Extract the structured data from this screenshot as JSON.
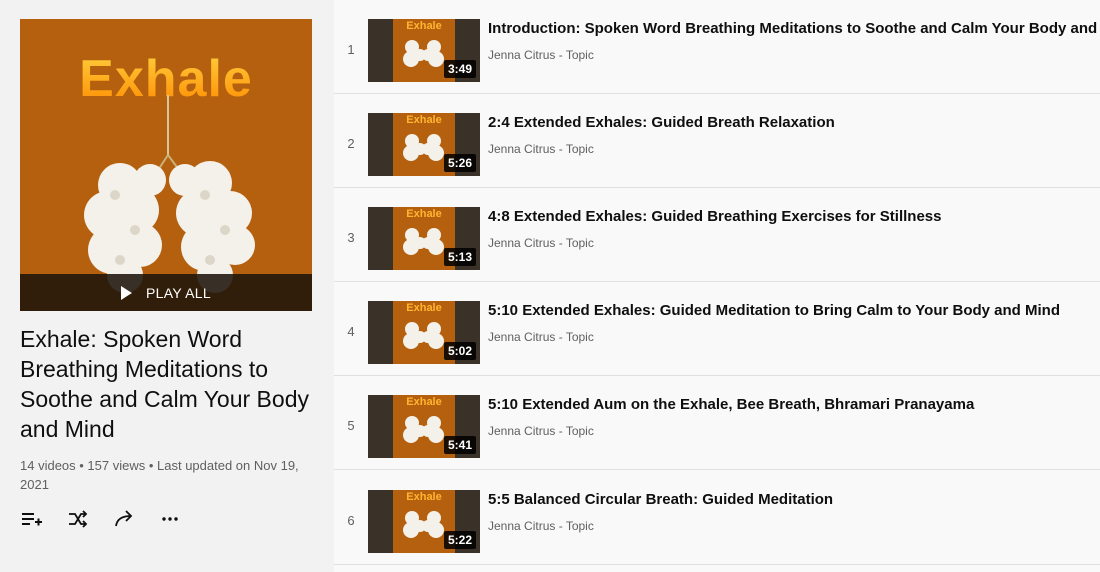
{
  "playlist": {
    "cover_title": "Exhale",
    "play_all_label": "PLAY ALL",
    "title": "Exhale: Spoken Word Breathing Meditations to Soothe and Calm Your Body and Mind",
    "meta": "14 videos • 157 views • Last updated on Nov 19, 2021",
    "colors": {
      "cover_bg": "#b5600f",
      "thumb_frame": "#3a3128"
    },
    "actions": [
      {
        "icon": "add-to-queue-icon"
      },
      {
        "icon": "shuffle-icon"
      },
      {
        "icon": "share-icon"
      },
      {
        "icon": "more-icon"
      }
    ]
  },
  "videos": [
    {
      "index": "1",
      "thumb_word": "Exhale",
      "duration": "3:49",
      "title": "Introduction: Spoken Word Breathing Meditations to Soothe and Calm Your Body and Mind",
      "channel": "Jenna Citrus - Topic"
    },
    {
      "index": "2",
      "thumb_word": "Exhale",
      "duration": "5:26",
      "title": "2:4 Extended Exhales: Guided Breath Relaxation",
      "channel": "Jenna Citrus - Topic"
    },
    {
      "index": "3",
      "thumb_word": "Exhale",
      "duration": "5:13",
      "title": "4:8 Extended Exhales: Guided Breathing Exercises for Stillness",
      "channel": "Jenna Citrus - Topic"
    },
    {
      "index": "4",
      "thumb_word": "Exhale",
      "duration": "5:02",
      "title": "5:10 Extended Exhales: Guided Meditation to Bring Calm to Your Body and Mind",
      "channel": "Jenna Citrus - Topic"
    },
    {
      "index": "5",
      "thumb_word": "Exhale",
      "duration": "5:41",
      "title": "5:10 Extended Aum on the Exhale, Bee Breath, Bhramari Pranayama",
      "channel": "Jenna Citrus - Topic"
    },
    {
      "index": "6",
      "thumb_word": "Exhale",
      "duration": "5:22",
      "title": "5:5 Balanced Circular Breath: Guided Meditation",
      "channel": "Jenna Citrus - Topic"
    }
  ]
}
